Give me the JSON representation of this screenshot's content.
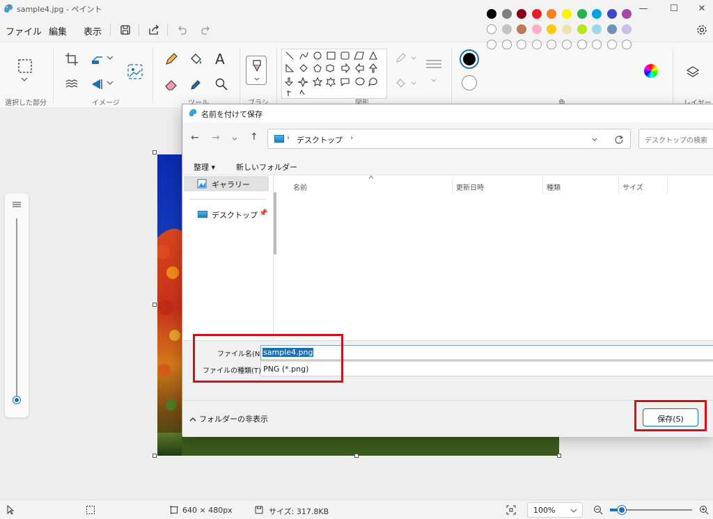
{
  "window": {
    "title": "sample4.jpg - ペイント",
    "minimize_glyph": "—",
    "maximize_glyph": "☐",
    "close_glyph": "✕"
  },
  "menu": {
    "file": "ファイル",
    "edit": "編集",
    "view": "表示"
  },
  "ribbon": {
    "groups": {
      "selection": "選択した部分",
      "image": "イメージ",
      "tools": "ツール",
      "brushes": "ブラシ",
      "shapes": "図形",
      "colors": "色",
      "layers": "レイヤー"
    },
    "text_tool_glyph": "A",
    "palette_row1": [
      "#000000",
      "#7f7f7f",
      "#880015",
      "#ed1c24",
      "#ff7f27",
      "#fff200",
      "#22b14c",
      "#00a2e8",
      "#3f48cc",
      "#a349a4"
    ],
    "palette_row2": [
      "#ffffff",
      "#c3c3c3",
      "#b97a57",
      "#ffaec9",
      "#ffc90e",
      "#efe4b0",
      "#b5e61d",
      "#99d9ea",
      "#7092be",
      "#c8bfe7"
    ],
    "primary_color": "#000000",
    "secondary_color": "#ffffff"
  },
  "dialog": {
    "title": "名前を付けて保存",
    "breadcrumb": [
      "デスクトップ"
    ],
    "search_placeholder": "デスクトップの検索",
    "organize": "整理",
    "new_folder": "新しいフォルダー",
    "nav_items": [
      {
        "label": "ギャラリー",
        "icon": "gallery-icon"
      },
      {
        "label": "デスクトップ",
        "icon": "desktop-icon"
      }
    ],
    "columns": [
      "名前",
      "更新日時",
      "種類",
      "サイズ"
    ],
    "filename_label": "ファイル名(N):",
    "filename_value": "sample4.png",
    "filetype_label": "ファイルの種類(T):",
    "filetype_value": "PNG (*.png)",
    "hide_folders": "フォルダーの非表示",
    "save_button": "保存(S)"
  },
  "status": {
    "dimensions": "640 × 480px",
    "size": "サイズ: 317.8KB",
    "zoom": "100%",
    "zoom_slider_fraction": 0.14
  }
}
